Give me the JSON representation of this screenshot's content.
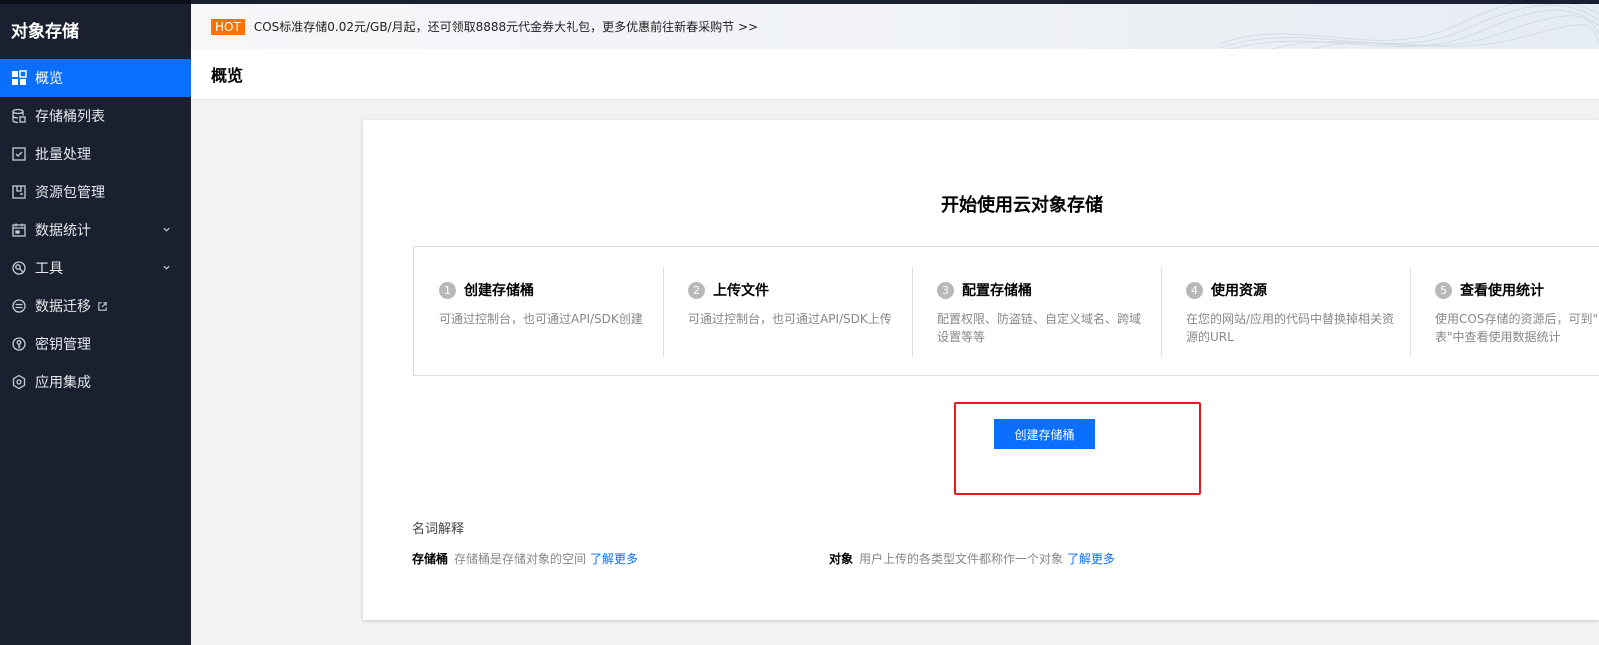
{
  "sidebar": {
    "title": "对象存储",
    "items": [
      {
        "label": "概览",
        "icon": "grid-icon",
        "active": true
      },
      {
        "label": "存储桶列表",
        "icon": "database-icon"
      },
      {
        "label": "批量处理",
        "icon": "checkbox-icon"
      },
      {
        "label": "资源包管理",
        "icon": "package-icon"
      },
      {
        "label": "数据统计",
        "icon": "calendar-icon",
        "expandable": true
      },
      {
        "label": "工具",
        "icon": "tools-icon",
        "expandable": true
      },
      {
        "label": "数据迁移",
        "icon": "migrate-icon",
        "external": true
      },
      {
        "label": "密钥管理",
        "icon": "key-icon"
      },
      {
        "label": "应用集成",
        "icon": "integration-icon"
      }
    ]
  },
  "topbar": {
    "badge": "HOT",
    "promo": "COS标准存储0.02元/GB/月起，还可领取8888元代金券大礼包，更多优惠前往新春采购节 >>"
  },
  "header": {
    "title": "概览"
  },
  "main": {
    "title": "开始使用云对象存储",
    "steps": [
      {
        "num": "1",
        "title": "创建存储桶",
        "desc1": "可通过控制台，也可通过API/SDK创建",
        "desc2": ""
      },
      {
        "num": "2",
        "title": "上传文件",
        "desc1": "可通过控制台，也可通过API/SDK上传",
        "desc2": ""
      },
      {
        "num": "3",
        "title": "配置存储桶",
        "desc1": "配置权限、防盗链、自定义域名、跨域",
        "desc2": "设置等等"
      },
      {
        "num": "4",
        "title": "使用资源",
        "desc1": "在您的网站/应用的代码中替换掉相关资",
        "desc2": "源的URL"
      },
      {
        "num": "5",
        "title": "查看使用统计",
        "desc1": "使用COS存储的资源后，可到\"",
        "desc2": "表\"中查看使用数据统计"
      }
    ],
    "create_button": "创建存储桶",
    "glossary": {
      "title": "名词解释",
      "terms": [
        {
          "name": "存储桶",
          "desc": "存储桶是存储对象的空间",
          "link": "了解更多"
        },
        {
          "name": "对象",
          "desc": "用户上传的各类型文件都称作一个对象",
          "link": "了解更多"
        }
      ]
    }
  },
  "colors": {
    "accent": "#0a6eff",
    "sidebar_bg": "#1b2030",
    "hot": "#ff7200",
    "highlight": "#e21c1c"
  }
}
